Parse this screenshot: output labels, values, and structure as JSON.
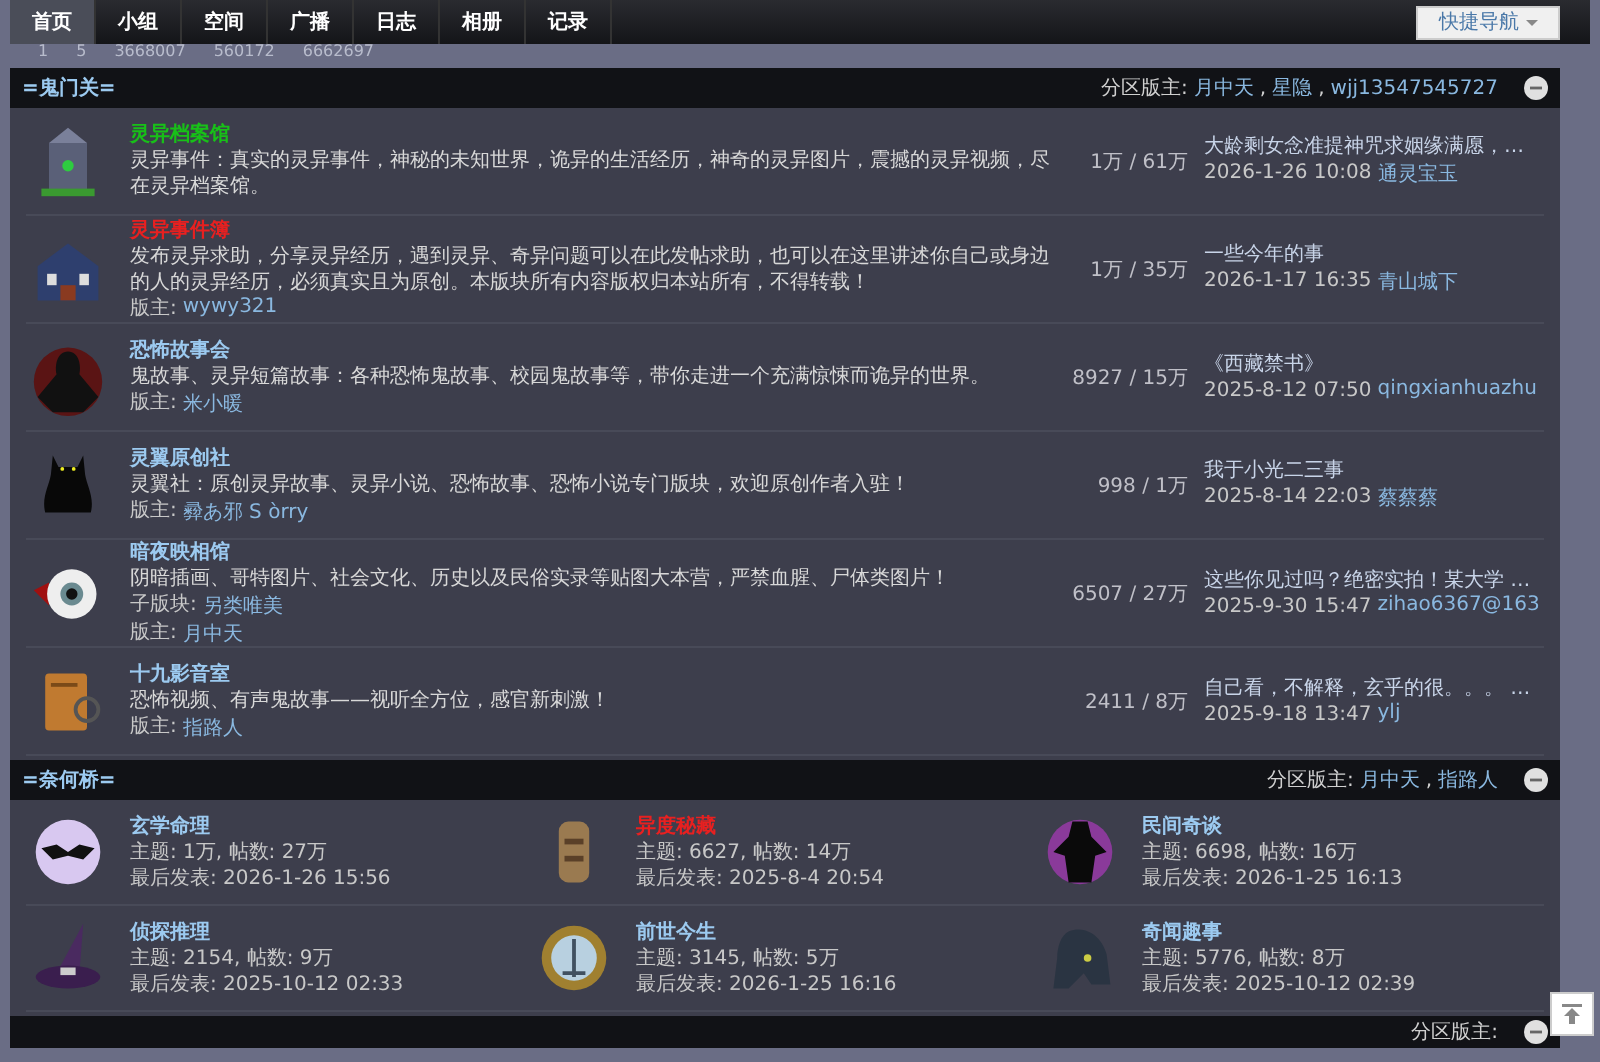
{
  "nav": {
    "tabs": [
      {
        "label": "首页",
        "selected": true
      },
      {
        "label": "小组",
        "selected": false
      },
      {
        "label": "空间",
        "selected": false
      },
      {
        "label": "广播",
        "selected": false
      },
      {
        "label": "日志",
        "selected": false
      },
      {
        "label": "相册",
        "selected": false
      },
      {
        "label": "记录",
        "selected": false
      }
    ],
    "quick_nav": "快捷导航"
  },
  "stats": [
    "1",
    "5",
    "3668007",
    "560172",
    "6662697"
  ],
  "section_1": {
    "title": "=鬼门关=",
    "moderators_label": "分区版主:",
    "moderators": [
      "月中天",
      "星隐",
      "wjj13547545727"
    ],
    "separator": ",",
    "forums": [
      {
        "name": "灵异档案馆",
        "color": "#18c018",
        "desc": "灵异事件：真实的灵异事件，神秘的未知世界，诡异的生活经历，神奇的灵异图片，震撼的灵异视频，尽在灵异档案馆。",
        "counts": "1万 / 61万",
        "last_title": "大龄剩女念准提神咒求姻缘满愿，…",
        "last_time": "2026-1-26 10:08",
        "last_user": "通灵宝玉"
      },
      {
        "name": "灵异事件簿",
        "color": "#e82020",
        "desc": "发布灵异求助，分享灵异经历，遇到灵异、奇异问题可以在此发帖求助，也可以在这里讲述你自己或身边的人的灵异经历，必须真实且为原创。本版块所有内容版权归本站所有，不得转载！",
        "mod_label": "版主:",
        "mod": "wywy321",
        "counts": "1万 / 35万",
        "last_title": "一些今年的事",
        "last_time": "2026-1-17 16:35",
        "last_user": "青山城下"
      },
      {
        "name": "恐怖故事会",
        "color": "#9ccaf0",
        "desc": "鬼故事、灵异短篇故事：各种恐怖鬼故事、校园鬼故事等，带你走进一个充满惊悚而诡异的世界。",
        "mod_label": "版主:",
        "mod": "米小暖",
        "counts": "8927 / 15万",
        "last_title": "《西藏禁书》",
        "last_time": "2025-8-12 07:50",
        "last_user": "qingxianhuazhu"
      },
      {
        "name": "灵翼原创社",
        "color": "#9ccaf0",
        "desc": "灵翼社：原创灵异故事、灵异小说、恐怖故事、恐怖小说专门版块，欢迎原创作者入驻！",
        "mod_label": "版主:",
        "mod": "彛あ邪 S òrry",
        "counts": "998 / 1万",
        "last_title": "我于小光二三事",
        "last_time": "2025-8-14 22:03",
        "last_user": "蔡蔡蔡"
      },
      {
        "name": "暗夜映相馆",
        "color": "#9ccaf0",
        "desc": "阴暗插画、哥特图片、社会文化、历史以及民俗实录等贴图大本营，严禁血腥、尸体类图片！",
        "sub_label": "子版块:",
        "sub": "另类唯美",
        "mod_label": "版主:",
        "mod": "月中天",
        "counts": "6507 / 27万",
        "last_title": "这些你见过吗？绝密实拍！某大学 …",
        "last_time": "2025-9-30 15:47",
        "last_user": "zihao6367@163"
      },
      {
        "name": "十九影音室",
        "color": "#9ccaf0",
        "desc": "恐怖视频、有声鬼故事——视听全方位，感官新刺激！",
        "mod_label": "版主:",
        "mod": "指路人",
        "counts": "2411 / 8万",
        "last_title": "自己看，不解释，玄乎的很。。。 …",
        "last_time": "2025-9-18 13:47",
        "last_user": "ylj"
      }
    ]
  },
  "section_2": {
    "title": "=奈何桥=",
    "moderators_label": "分区版主:",
    "moderators": [
      "月中天",
      "指路人"
    ],
    "separator": ",",
    "forums": [
      {
        "name": "玄学命理",
        "color": "#9ccaf0",
        "stats": "主题: 1万, 帖数: 27万",
        "last": "最后发表: 2026-1-26 15:56"
      },
      {
        "name": "异度秘藏",
        "color": "#e82020",
        "stats": "主题: 6627, 帖数: 14万",
        "last": "最后发表: 2025-8-4 20:54"
      },
      {
        "name": "民间奇谈",
        "color": "#9ccaf0",
        "stats": "主题: 6698, 帖数: 16万",
        "last": "最后发表: 2026-1-25 16:13"
      },
      {
        "name": "侦探推理",
        "color": "#9ccaf0",
        "stats": "主题: 2154, 帖数: 9万",
        "last": "最后发表: 2025-10-12 02:33"
      },
      {
        "name": "前世今生",
        "color": "#9ccaf0",
        "stats": "主题: 3145, 帖数: 5万",
        "last": "最后发表: 2026-1-25 16:16"
      },
      {
        "name": "奇闻趣事",
        "color": "#9ccaf0",
        "stats": "主题: 5776, 帖数: 8万",
        "last": "最后发表: 2025-10-12 02:39"
      }
    ]
  },
  "section_3": {
    "moderators_label": "分区版主:"
  }
}
